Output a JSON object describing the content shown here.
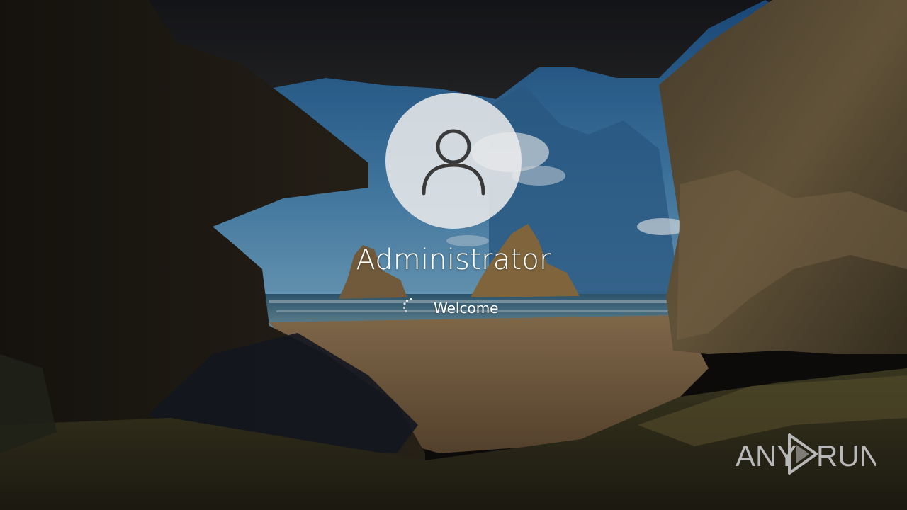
{
  "login": {
    "username": "Administrator",
    "status_text": "Welcome"
  },
  "avatar": {
    "icon": "user-silhouette-icon"
  },
  "watermark": {
    "text_left": "ANY",
    "text_right": "RUN",
    "icon": "play-triangle-icon"
  },
  "colors": {
    "avatar_bg": "#ececec",
    "avatar_icon": "#3a3a3a",
    "text": "#ffffff",
    "watermark": "#b8b8b8"
  }
}
